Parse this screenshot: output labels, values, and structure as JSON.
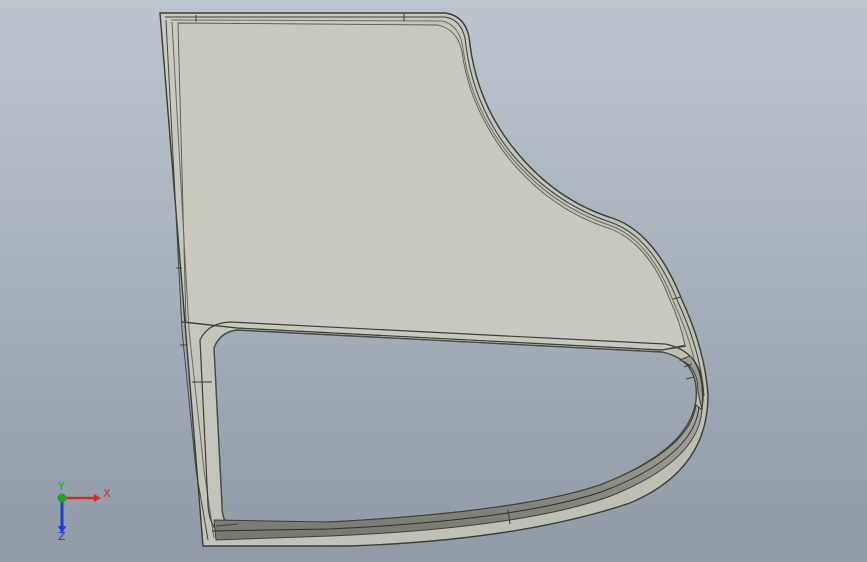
{
  "view": {
    "background_top": "#bcc5cd",
    "background_bottom": "#8f9aa6",
    "part_color": "#c5c6bd",
    "edge_color": "#3d3f3a"
  },
  "triad": {
    "x_label": "X",
    "y_label": "Y",
    "z_label": "Z",
    "x_color": "#d12a2a",
    "y_color": "#2aa12a",
    "z_color": "#2a3bd1"
  }
}
